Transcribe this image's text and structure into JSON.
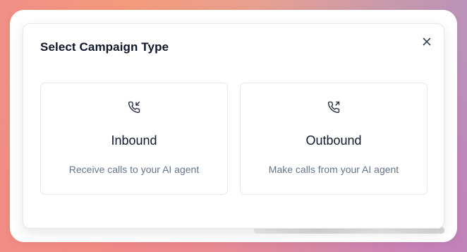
{
  "modal": {
    "title": "Select Campaign Type",
    "close_icon": "close-icon"
  },
  "options": [
    {
      "title": "Inbound",
      "description": "Receive calls to your AI agent",
      "icon": "phone-incoming-icon"
    },
    {
      "title": "Outbound",
      "description": "Make calls from your AI agent",
      "icon": "phone-outgoing-icon"
    }
  ],
  "colors": {
    "title": "#0f172a",
    "description": "#64748b",
    "border": "#e5e7eb"
  }
}
